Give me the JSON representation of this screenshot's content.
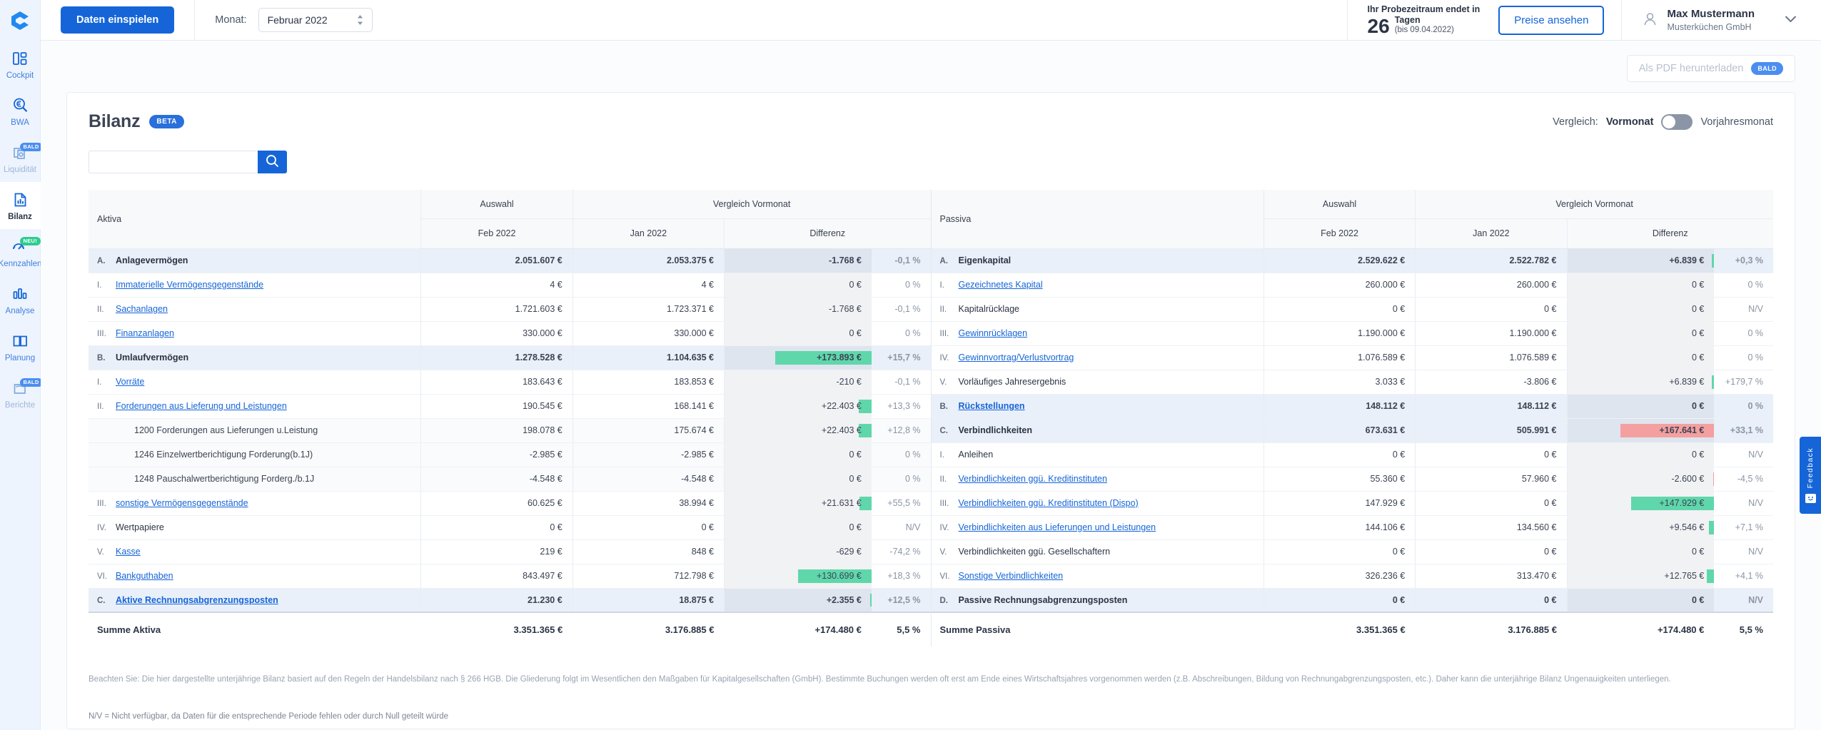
{
  "sidebar": {
    "logo_icon": "agicap-logo-icon",
    "items": [
      {
        "label": "Cockpit",
        "icon": "dashboard-icon",
        "badge": null,
        "state": "normal"
      },
      {
        "label": "BWA",
        "icon": "euro-search-icon",
        "badge": null,
        "state": "normal"
      },
      {
        "label": "Liquidität",
        "icon": "liquidity-icon",
        "badge": "BALD",
        "state": "soon"
      },
      {
        "label": "Bilanz",
        "icon": "balance-doc-icon",
        "badge": null,
        "state": "active"
      },
      {
        "label": "Kennzahlen",
        "icon": "kpi-icon",
        "badge": "NEU!",
        "state": "normal"
      },
      {
        "label": "Analyse",
        "icon": "bar-chart-icon",
        "badge": null,
        "state": "normal"
      },
      {
        "label": "Planung",
        "icon": "book-icon",
        "badge": null,
        "state": "normal"
      },
      {
        "label": "Berichte",
        "icon": "reports-icon",
        "badge": "BALD",
        "state": "soon"
      }
    ]
  },
  "topbar": {
    "import_button": "Daten einspielen",
    "month_label": "Monat:",
    "month_value": "Februar 2022",
    "trial_prefix": "Ihr Probezeitraum endet in",
    "trial_number": "26",
    "trial_unit": "Tagen",
    "trial_until": "(bis 09.04.2022)",
    "prices_button": "Preise ansehen",
    "user_name": "Max Mustermann",
    "user_company": "Musterküchen GmbH",
    "user_icon": "user-avatar-icon",
    "chevron_icon": "chevron-down-icon"
  },
  "toolbar": {
    "pdf_label": "Als PDF herunterladen",
    "pdf_badge": "BALD"
  },
  "header": {
    "title": "Bilanz",
    "beta_badge": "BETA",
    "compare_label": "Vergleich:",
    "compare_option_left": "Vormonat",
    "compare_option_right": "Vorjahresmonat",
    "toggle_state": "left"
  },
  "search": {
    "value": "",
    "placeholder": "",
    "icon": "search-icon"
  },
  "chart_data": {
    "type": "table",
    "title": "Bilanz",
    "columns": {
      "group_selection": "Auswahl",
      "group_compare": "Vergleich Vormonat",
      "period_current": "Feb 2022",
      "period_previous": "Jan 2022",
      "difference": "Differenz"
    },
    "tables": [
      {
        "side": "aktiva",
        "header": "Aktiva",
        "summary": {
          "label": "Summe Aktiva",
          "current": "3.351.365 €",
          "previous": "3.176.885 €",
          "diff": "+174.480 €",
          "pct": "5,5 %"
        },
        "rows": [
          {
            "level": "A",
            "num": "A.",
            "label": "Anlagevermögen",
            "link": false,
            "current": "2.051.607 €",
            "previous": "2.053.375 €",
            "diff": "-1.768 €",
            "pct": "-0,1 %",
            "bar_pct": 0,
            "bar_sign": "neg"
          },
          {
            "level": "I",
            "num": "I.",
            "label": "Immaterielle Vermögensgegenstände",
            "link": true,
            "current": "4 €",
            "previous": "4 €",
            "diff": "0 €",
            "pct": "0 %",
            "bar_pct": 0,
            "bar_sign": "zero"
          },
          {
            "level": "I",
            "num": "II.",
            "label": "Sachanlagen",
            "link": true,
            "current": "1.721.603 €",
            "previous": "1.723.371 €",
            "diff": "-1.768 €",
            "pct": "-0,1 %",
            "bar_pct": 0,
            "bar_sign": "neg"
          },
          {
            "level": "I",
            "num": "III.",
            "label": "Finanzanlagen",
            "link": true,
            "current": "330.000 €",
            "previous": "330.000 €",
            "diff": "0 €",
            "pct": "0 %",
            "bar_pct": 0,
            "bar_sign": "zero"
          },
          {
            "level": "A",
            "num": "B.",
            "label": "Umlaufvermögen",
            "link": false,
            "current": "1.278.528 €",
            "previous": "1.104.635 €",
            "diff": "+173.893 €",
            "pct": "+15,7 %",
            "bar_pct": 88,
            "bar_sign": "pos"
          },
          {
            "level": "I",
            "num": "I.",
            "label": "Vorräte",
            "link": true,
            "current": "183.643 €",
            "previous": "183.853 €",
            "diff": "-210 €",
            "pct": "-0,1 %",
            "bar_pct": 0,
            "bar_sign": "neg"
          },
          {
            "level": "I",
            "num": "II.",
            "label": "Forderungen aus Lieferung und Leistungen",
            "link": true,
            "current": "190.545 €",
            "previous": "168.141 €",
            "diff": "+22.403 €",
            "pct": "+13,3 %",
            "bar_pct": 12,
            "bar_sign": "pos"
          },
          {
            "level": "K",
            "num": "",
            "label": "1200 Forderungen aus Lieferungen u.Leistung",
            "link": false,
            "current": "198.078 €",
            "previous": "175.674 €",
            "diff": "+22.403 €",
            "pct": "+12,8 %",
            "bar_pct": 12,
            "bar_sign": "pos"
          },
          {
            "level": "K",
            "num": "",
            "label": "1246 Einzelwertberichtigung Forderung(b.1J)",
            "link": false,
            "current": "-2.985 €",
            "previous": "-2.985 €",
            "diff": "0 €",
            "pct": "0 %",
            "bar_pct": 0,
            "bar_sign": "zero"
          },
          {
            "level": "K",
            "num": "",
            "label": "1248 Pauschalwertberichtigung Forderg./b.1J",
            "link": false,
            "current": "-4.548 €",
            "previous": "-4.548 €",
            "diff": "0 €",
            "pct": "0 %",
            "bar_pct": 0,
            "bar_sign": "zero"
          },
          {
            "level": "I",
            "num": "III.",
            "label": "sonstige Vermögensgegenstände",
            "link": true,
            "current": "60.625 €",
            "previous": "38.994 €",
            "diff": "+21.631 €",
            "pct": "+55,5 %",
            "bar_pct": 11,
            "bar_sign": "pos"
          },
          {
            "level": "I",
            "num": "IV.",
            "label": "Wertpapiere",
            "link": false,
            "current": "0 €",
            "previous": "0 €",
            "diff": "0 €",
            "pct": "N/V",
            "bar_pct": 0,
            "bar_sign": "zero"
          },
          {
            "level": "I",
            "num": "V.",
            "label": "Kasse",
            "link": true,
            "current": "219 €",
            "previous": "848 €",
            "diff": "-629 €",
            "pct": "-74,2 %",
            "bar_pct": 0,
            "bar_sign": "neg"
          },
          {
            "level": "I",
            "num": "VI.",
            "label": "Bankguthaben",
            "link": true,
            "current": "843.497 €",
            "previous": "712.798 €",
            "diff": "+130.699 €",
            "pct": "+18,3 %",
            "bar_pct": 67,
            "bar_sign": "pos"
          },
          {
            "level": "A",
            "num": "C.",
            "label": "Aktive Rechnungsabgrenzungsposten",
            "link": true,
            "current": "21.230 €",
            "previous": "18.875 €",
            "diff": "+2.355 €",
            "pct": "+12,5 %",
            "bar_pct": 1.5,
            "bar_sign": "pos"
          }
        ]
      },
      {
        "side": "passiva",
        "header": "Passiva",
        "summary": {
          "label": "Summe Passiva",
          "current": "3.351.365 €",
          "previous": "3.176.885 €",
          "diff": "+174.480 €",
          "pct": "5,5 %"
        },
        "rows": [
          {
            "level": "A",
            "num": "A.",
            "label": "Eigenkapital",
            "link": false,
            "current": "2.529.622 €",
            "previous": "2.522.782 €",
            "diff": "+6.839 €",
            "pct": "+0,3 %",
            "bar_pct": 2.2,
            "bar_sign": "pos"
          },
          {
            "level": "I",
            "num": "I.",
            "label": "Gezeichnetes Kapital",
            "link": true,
            "current": "260.000 €",
            "previous": "260.000 €",
            "diff": "0 €",
            "pct": "0 %",
            "bar_pct": 0,
            "bar_sign": "zero"
          },
          {
            "level": "I",
            "num": "II.",
            "label": "Kapitalrücklage",
            "link": false,
            "current": "0 €",
            "previous": "0 €",
            "diff": "0 €",
            "pct": "N/V",
            "bar_pct": 0,
            "bar_sign": "zero"
          },
          {
            "level": "I",
            "num": "III.",
            "label": "Gewinnrücklagen",
            "link": true,
            "current": "1.190.000 €",
            "previous": "1.190.000 €",
            "diff": "0 €",
            "pct": "0 %",
            "bar_pct": 0,
            "bar_sign": "zero"
          },
          {
            "level": "I",
            "num": "IV.",
            "label": "Gewinnvortrag/Verlustvortrag",
            "link": true,
            "current": "1.076.589 €",
            "previous": "1.076.589 €",
            "diff": "0 €",
            "pct": "0 %",
            "bar_pct": 0,
            "bar_sign": "zero"
          },
          {
            "level": "I",
            "num": "V.",
            "label": "Vorläufiges Jahresergebnis",
            "link": false,
            "current": "3.033 €",
            "previous": "-3.806 €",
            "diff": "+6.839 €",
            "pct": "+179,7 %",
            "bar_pct": 2.2,
            "bar_sign": "pos"
          },
          {
            "level": "A",
            "num": "B.",
            "label": "Rückstellungen",
            "link": true,
            "current": "148.112 €",
            "previous": "148.112 €",
            "diff": "0 €",
            "pct": "0 %",
            "bar_pct": 0,
            "bar_sign": "zero"
          },
          {
            "level": "A",
            "num": "C.",
            "label": "Verbindlichkeiten",
            "link": false,
            "current": "673.631 €",
            "previous": "505.991 €",
            "diff": "+167.641 €",
            "pct": "+33,1 %",
            "bar_pct": 86,
            "bar_sign": "neg"
          },
          {
            "level": "I",
            "num": "I.",
            "label": "Anleihen",
            "link": false,
            "current": "0 €",
            "previous": "0 €",
            "diff": "0 €",
            "pct": "N/V",
            "bar_pct": 0,
            "bar_sign": "zero"
          },
          {
            "level": "I",
            "num": "II.",
            "label": "Verbindlichkeiten ggü. Kreditinstituten",
            "link": true,
            "current": "55.360 €",
            "previous": "57.960 €",
            "diff": "-2.600 €",
            "pct": "-4,5 %",
            "bar_pct": 0.6,
            "bar_sign": "negthin"
          },
          {
            "level": "I",
            "num": "III.",
            "label": "Verbindlichkeiten ggü. Kreditinstituten (Dispo)",
            "link": true,
            "current": "147.929 €",
            "previous": "0 €",
            "diff": "+147.929 €",
            "pct": "N/V",
            "bar_pct": 76,
            "bar_sign": "pos"
          },
          {
            "level": "I",
            "num": "IV.",
            "label": "Verbindlichkeiten aus Lieferungen und Leistungen",
            "link": true,
            "current": "144.106 €",
            "previous": "134.560 €",
            "diff": "+9.546 €",
            "pct": "+7,1 %",
            "bar_pct": 5,
            "bar_sign": "pos"
          },
          {
            "level": "I",
            "num": "V.",
            "label": "Verbindlichkeiten ggü. Gesellschaftern",
            "link": false,
            "current": "0 €",
            "previous": "0 €",
            "diff": "0 €",
            "pct": "N/V",
            "bar_pct": 0,
            "bar_sign": "zero"
          },
          {
            "level": "I",
            "num": "VI.",
            "label": "Sonstige Verbindlichkeiten",
            "link": true,
            "current": "326.236 €",
            "previous": "313.470 €",
            "diff": "+12.765 €",
            "pct": "+4,1 %",
            "bar_pct": 6.5,
            "bar_sign": "pos"
          },
          {
            "level": "A",
            "num": "D.",
            "label": "Passive Rechnungsabgrenzungsposten",
            "link": false,
            "current": "0 €",
            "previous": "0 €",
            "diff": "0 €",
            "pct": "N/V",
            "bar_pct": 0,
            "bar_sign": "zero"
          }
        ]
      }
    ]
  },
  "notes": {
    "note1": "Beachten Sie: Die hier dargestellte unterjährige Bilanz basiert auf den Regeln der Handelsbilanz nach § 266 HGB. Die Gliederung folgt im Wesentlichen den Maßgaben für Kapitalgesellschaften (GmbH). Bestimmte Buchungen werden oft erst am Ende eines Wirtschaftsjahres vorgenommen werden (z.B. Abschreibungen, Bildung von Rechnungabgrenzungsposten, etc.). Daher kann die unterjährige Bilanz Ungenauigkeiten unterliegen.",
    "note2": "N/V = Nicht verfügbar, da Daten für die entsprechende Periode fehlen oder durch Null geteilt würde"
  },
  "feedback": {
    "label": "Feedback",
    "icon": "smiley-icon"
  },
  "colors": {
    "brand_blue": "#1565d8",
    "positive_green": "#5fd7ab",
    "negative_red": "#f4a0a0",
    "sidebar_bg": "#eef4fd"
  }
}
